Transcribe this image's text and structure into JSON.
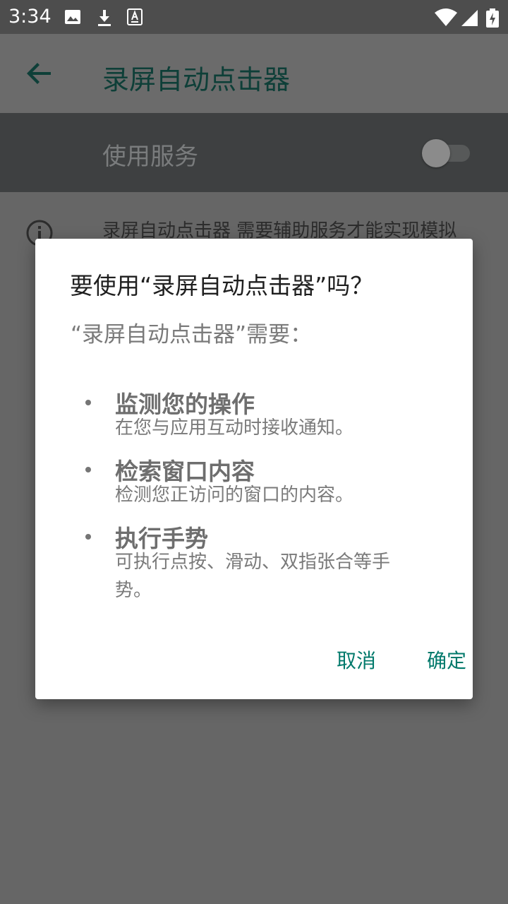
{
  "status_bar": {
    "time": "3:34"
  },
  "app_bar": {
    "title": "录屏自动点击器"
  },
  "service": {
    "label": "使用服务",
    "enabled": false
  },
  "info": {
    "text": "录屏自动点击器 需要辅助服务才能实现模拟"
  },
  "dialog": {
    "title": "要使用“录屏自动点击器”吗？",
    "subtitle": "“录屏自动点击器”需要：",
    "permissions": [
      {
        "title": "监测您的操作",
        "desc": "在您与应用互动时接收通知。"
      },
      {
        "title": "检索窗口内容",
        "desc": "检测您正访问的窗口的内容。"
      },
      {
        "title": "执行手势",
        "desc": "可执行点按、滑动、双指张合等手势。"
      }
    ],
    "cancel_label": "取消",
    "ok_label": "确定"
  },
  "colors": {
    "accent": "#00796b",
    "dark_title": "#0e3f38"
  }
}
